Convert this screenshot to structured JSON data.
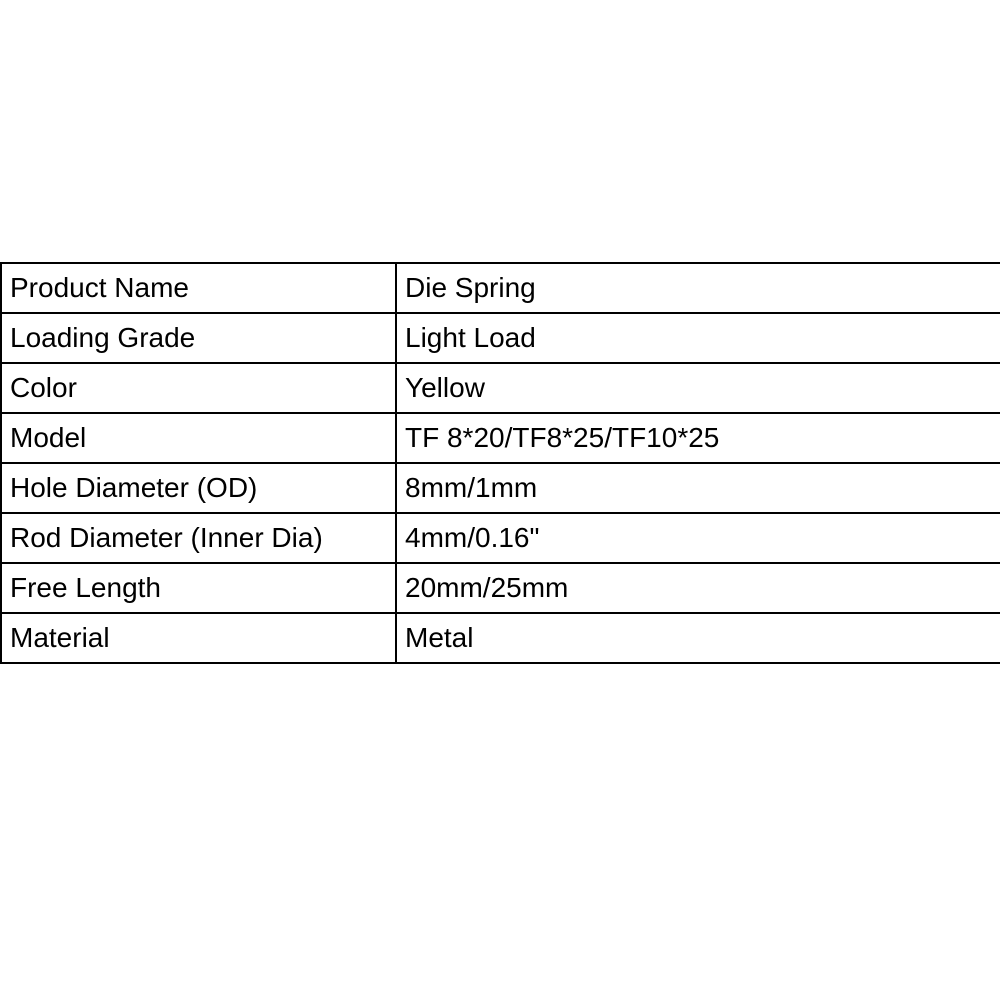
{
  "specs": {
    "rows": [
      {
        "label": "Product Name",
        "value": "Die Spring"
      },
      {
        "label": "Loading Grade",
        "value": "Light Load"
      },
      {
        "label": "Color",
        "value": "Yellow"
      },
      {
        "label": "Model",
        "value": "TF 8*20/TF8*25/TF10*25"
      },
      {
        "label": "Hole Diameter (OD)",
        "value": "8mm/1mm"
      },
      {
        "label": "Rod Diameter (Inner Dia)",
        "value": "4mm/0.16\""
      },
      {
        "label": "Free Length",
        "value": "20mm/25mm"
      },
      {
        "label": "Material",
        "value": "Metal"
      }
    ]
  }
}
